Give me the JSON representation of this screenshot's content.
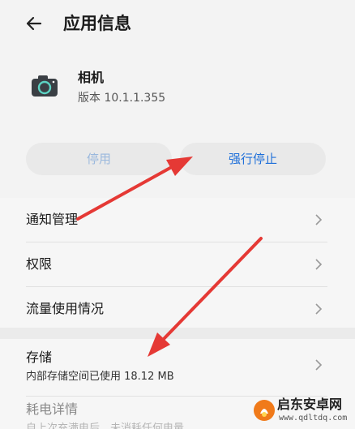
{
  "header": {
    "title": "应用信息"
  },
  "app": {
    "name": "相机",
    "version": "版本 10.1.1.355"
  },
  "buttons": {
    "disable": "停用",
    "force_stop": "强行停止"
  },
  "list": [
    {
      "label": "通知管理"
    },
    {
      "label": "权限"
    },
    {
      "label": "流量使用情况"
    }
  ],
  "storage": {
    "label": "存储",
    "detail": "内部存储空间已使用 18.12 MB"
  },
  "power": {
    "label": "耗电详情",
    "detail": "自上次充满电后，未消耗任何电量"
  },
  "watermark": {
    "name": "启东安卓网",
    "url": "www.qdltdq.com"
  },
  "colors": {
    "accent": "#1e6fd9",
    "arrow": "#e53935",
    "background": "#f3f3f3"
  }
}
